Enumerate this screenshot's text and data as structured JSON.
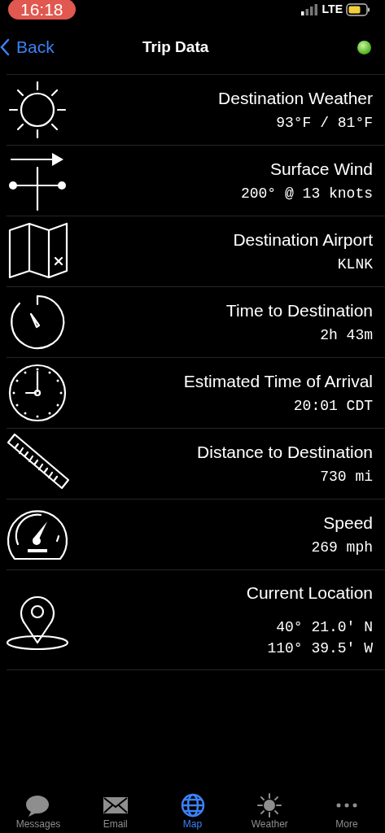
{
  "status_bar": {
    "time": "16:18",
    "network": "LTE"
  },
  "nav": {
    "back": "Back",
    "title": "Trip Data",
    "connected": true
  },
  "rows": [
    {
      "kind": "weather",
      "label": "Destination Weather",
      "values": [
        "93°F / 81°F"
      ]
    },
    {
      "kind": "wind",
      "label": "Surface Wind",
      "values": [
        "200° @ 13 knots"
      ]
    },
    {
      "kind": "map",
      "label": "Destination Airport",
      "values": [
        "KLNK"
      ]
    },
    {
      "kind": "timer",
      "label": "Time to Destination",
      "values": [
        "2h 43m"
      ]
    },
    {
      "kind": "clock",
      "label": "Estimated Time of Arrival",
      "values": [
        "20:01 CDT"
      ]
    },
    {
      "kind": "ruler",
      "label": "Distance to Destination",
      "values": [
        "730 mi"
      ]
    },
    {
      "kind": "speed",
      "label": "Speed",
      "values": [
        "269 mph"
      ]
    },
    {
      "kind": "location",
      "label": "Current Location",
      "values": [
        "40° 21.0' N",
        "110° 39.5' W"
      ]
    }
  ],
  "tabs": [
    {
      "kind": "messages",
      "label": "Messages",
      "selected": false
    },
    {
      "kind": "email",
      "label": "Email",
      "selected": false
    },
    {
      "kind": "map",
      "label": "Map",
      "selected": true
    },
    {
      "kind": "weather",
      "label": "Weather",
      "selected": false
    },
    {
      "kind": "more",
      "label": "More",
      "selected": false
    }
  ]
}
